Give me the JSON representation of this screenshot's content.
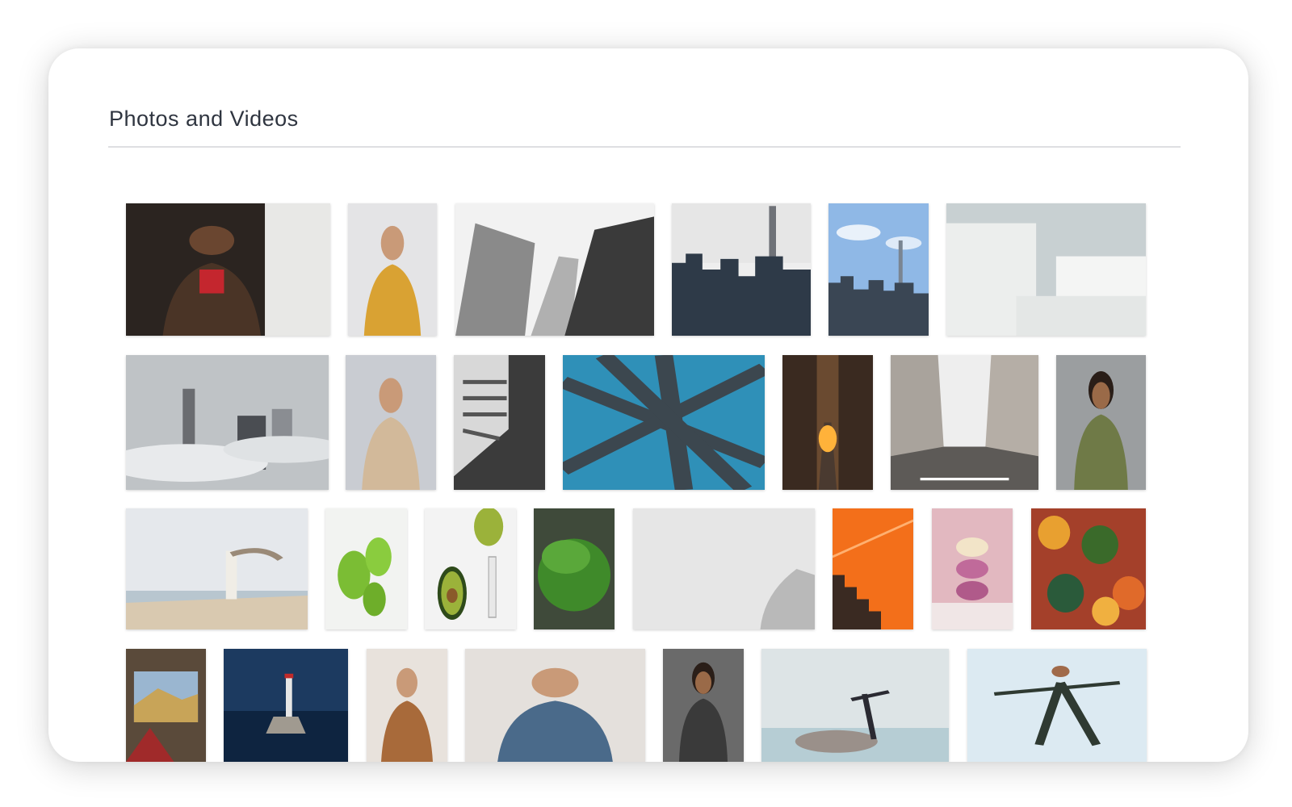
{
  "header": {
    "title": "Photos and Videos"
  },
  "gallery": {
    "items": [
      {
        "id": "portrait-woman-leather-jacket",
        "bg": "#2b2420",
        "accent": "#c4262e",
        "kind": "portrait-dark"
      },
      {
        "id": "woman-yellow-coat-brick-wall",
        "bg": "#e4e4e6",
        "accent": "#d9a233",
        "kind": "portrait-light"
      },
      {
        "id": "skyscrapers-looking-up-bw",
        "bg": "#f2f2f2",
        "accent": "#3a3a3a",
        "kind": "towers-bw"
      },
      {
        "id": "city-skyline-transparent-bg",
        "bg": "#dcdcdc",
        "accent": "#2e3a48",
        "kind": "skyline-checker"
      },
      {
        "id": "city-skyline-blue-sky",
        "bg": "#8fb8e6",
        "accent": "#3a4654",
        "kind": "skyline-sky"
      },
      {
        "id": "white-geometric-blocks",
        "bg": "#c8d0d2",
        "accent": "#eceeed",
        "kind": "blocks"
      },
      {
        "id": "city-above-clouds",
        "bg": "#bfc3c6",
        "accent": "#6a6c70",
        "kind": "clouds"
      },
      {
        "id": "man-beige-jacket",
        "bg": "#c9ccd2",
        "accent": "#d2b99a",
        "kind": "portrait-light"
      },
      {
        "id": "black-white-building-lines",
        "bg": "#3b3b3b",
        "accent": "#e6e6e6",
        "kind": "lines"
      },
      {
        "id": "steel-bridge-beams-blue-sky",
        "bg": "#2f90b8",
        "accent": "#3c474f",
        "kind": "beams"
      },
      {
        "id": "city-sunset-street",
        "bg": "#6a4a30",
        "accent": "#ffb23a",
        "kind": "sunset"
      },
      {
        "id": "empty-street-transparent-sky",
        "bg": "#dcdcdc",
        "accent": "#5d5a57",
        "kind": "street-checker"
      },
      {
        "id": "man-green-sweater",
        "bg": "#9b9ea0",
        "accent": "#6f7a47",
        "kind": "portrait-grey"
      },
      {
        "id": "woman-on-beach-with-scarf",
        "bg": "#e5e8ec",
        "accent": "#d9c9b0",
        "kind": "beach"
      },
      {
        "id": "green-apples",
        "bg": "#f2f3f1",
        "accent": "#7bbd34",
        "kind": "apples"
      },
      {
        "id": "avocado-halves",
        "bg": "#f3f3f3",
        "accent": "#9bb23a",
        "kind": "avocado"
      },
      {
        "id": "leafy-greens",
        "bg": "#3f4a3a",
        "accent": "#3f8a2a",
        "kind": "greens"
      },
      {
        "id": "grey-concrete-cloth",
        "bg": "#e6e6e6",
        "accent": "#b9b9b9",
        "kind": "concrete"
      },
      {
        "id": "orange-wall-staircase",
        "bg": "#f36f1a",
        "accent": "#3a2a22",
        "kind": "stairs"
      },
      {
        "id": "pink-macarons",
        "bg": "#e2b8c0",
        "accent": "#c06a9a",
        "kind": "macarons"
      },
      {
        "id": "autumn-forest-aerial",
        "bg": "#a4402a",
        "accent": "#e8a030",
        "kind": "forest"
      },
      {
        "id": "car-window-mountain-view",
        "bg": "#5a4a3a",
        "accent": "#c8a458",
        "kind": "car"
      },
      {
        "id": "lighthouse-coast-night",
        "bg": "#1c3a60",
        "accent": "#e6e6e6",
        "kind": "lighthouse"
      },
      {
        "id": "woman-smiling-brown-blazer",
        "bg": "#e8e2dc",
        "accent": "#a86a3a",
        "kind": "portrait-light"
      },
      {
        "id": "woman-denim-jacket-plants",
        "bg": "#e4e0dc",
        "accent": "#4a6a8a",
        "kind": "portrait-light"
      },
      {
        "id": "woman-workout-back",
        "bg": "#6a6a6a",
        "accent": "#3a3a3a",
        "kind": "portrait-grey"
      },
      {
        "id": "yoga-by-the-sea",
        "bg": "#dde4e6",
        "accent": "#6a9aaa",
        "kind": "yoga-sea"
      },
      {
        "id": "yoga-pose-sky",
        "bg": "#dceaf2",
        "accent": "#2f3a32",
        "kind": "yoga-sky"
      }
    ]
  }
}
